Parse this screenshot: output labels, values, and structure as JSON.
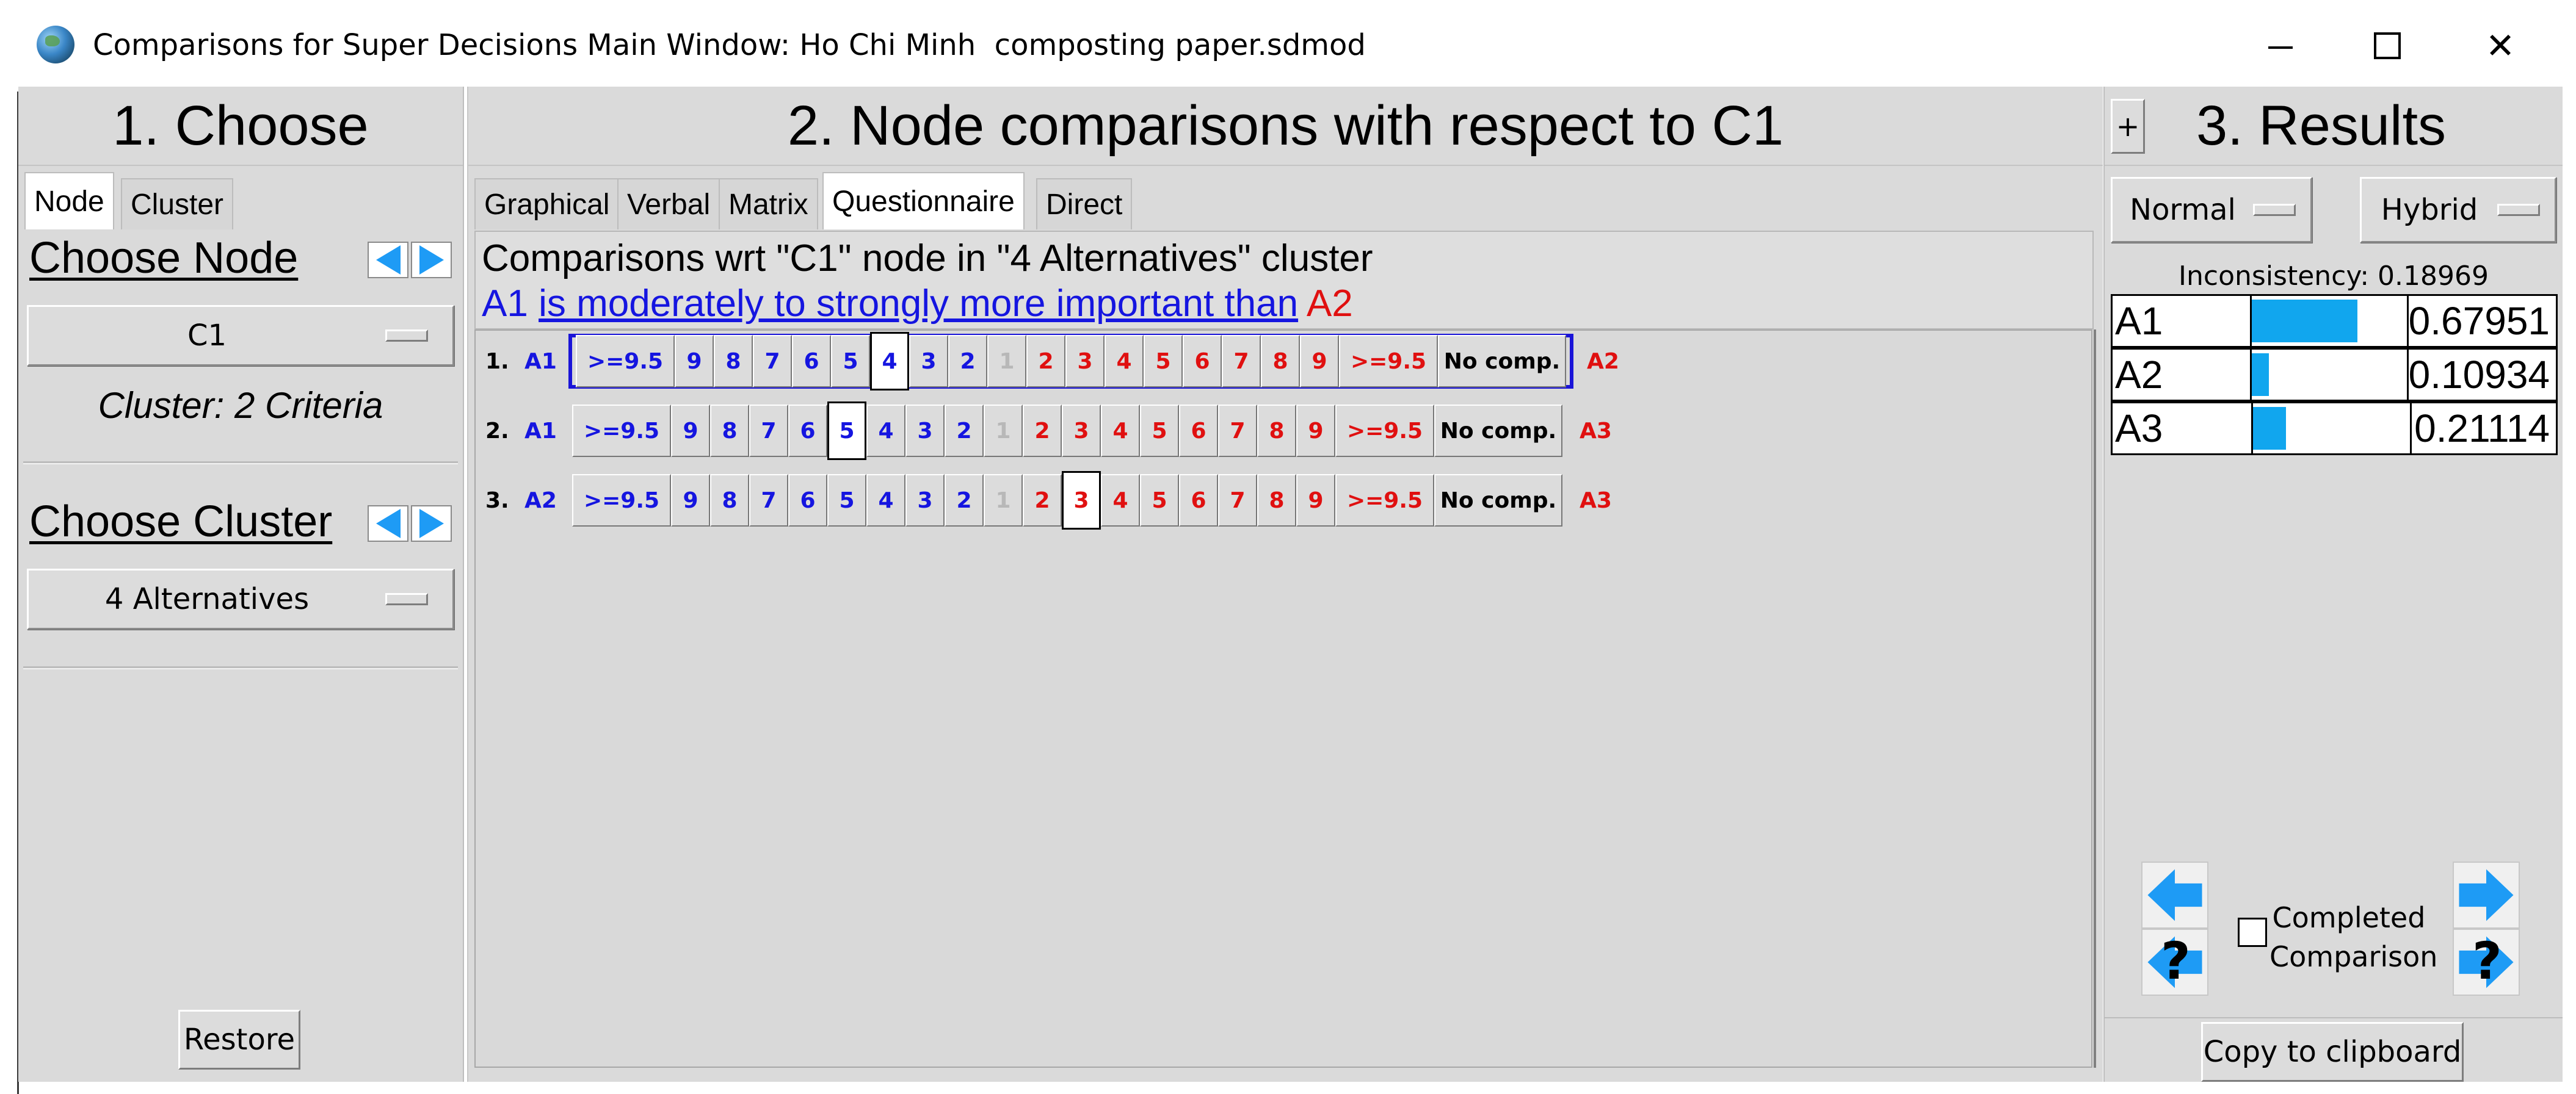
{
  "window": {
    "title": "Comparisons for Super Decisions Main Window: Ho Chi Minh  composting paper.sdmod",
    "minimize": "",
    "maximize": "",
    "close": "✕"
  },
  "choose": {
    "header": "1. Choose",
    "tabs": [
      "Node",
      "Cluster"
    ],
    "choose_node_label": "Choose Node",
    "node_value": "C1",
    "cluster_caption": "Cluster: 2 Criteria",
    "choose_cluster_label": "Choose Cluster",
    "cluster_value": "4 Alternatives",
    "restore_label": "Restore"
  },
  "compare": {
    "header": "2. Node comparisons with respect to C1",
    "tabs": [
      "Graphical",
      "Verbal",
      "Matrix",
      "Questionnaire",
      "Direct"
    ],
    "active_tab": "Questionnaire",
    "desc_line1": "Comparisons wrt \"C1\" node in \"4 Alternatives\" cluster",
    "desc_left": "A1",
    "desc_link": "is moderately to strongly more important than",
    "desc_right": "A2",
    "scale": [
      ">=9.5",
      "9",
      "8",
      "7",
      "6",
      "5",
      "4",
      "3",
      "2",
      "1",
      "2",
      "3",
      "4",
      "5",
      "6",
      "7",
      "8",
      "9",
      ">=9.5",
      "No comp."
    ],
    "rows": [
      {
        "num": "1.",
        "left": "A1",
        "right": "A2",
        "selected_index": 6,
        "row_selected": true
      },
      {
        "num": "2.",
        "left": "A1",
        "right": "A3",
        "selected_index": 5,
        "row_selected": false
      },
      {
        "num": "3.",
        "left": "A2",
        "right": "A3",
        "selected_index": 11,
        "row_selected": false
      }
    ],
    "colors": {
      "left": "#1515e0",
      "right": "#e01010",
      "neutral": "#b8b8b8"
    }
  },
  "results": {
    "plus_label": "+",
    "header": "3. Results",
    "mode_left": "Normal",
    "mode_right": "Hybrid",
    "inconsistency": "Inconsistency: 0.18969",
    "rows": [
      {
        "name": "A1",
        "value": "0.67951",
        "fraction": 0.67951
      },
      {
        "name": "A2",
        "value": "0.10934",
        "fraction": 0.10934
      },
      {
        "name": "A3",
        "value": "0.21114",
        "fraction": 0.21114
      }
    ],
    "qmark": "?",
    "completed_label_1": "Completed",
    "completed_label_2": "Comparison",
    "copy_label": "Copy to clipboard",
    "bar_color": "#11a6ee"
  }
}
